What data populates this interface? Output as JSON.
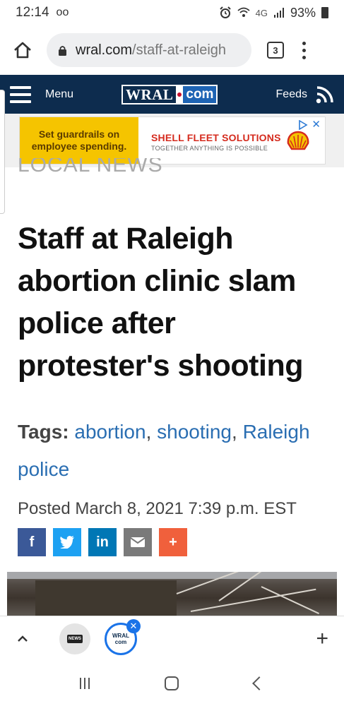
{
  "status_bar": {
    "time": "12:14",
    "voicemail": "oo",
    "network": "4G",
    "battery": "93%"
  },
  "browser": {
    "url_host": "wral.com",
    "url_path": "/staff-at-raleigh",
    "tab_count": "3"
  },
  "site_header": {
    "menu_label": "Menu",
    "logo_wral": "WRAL",
    "logo_com": "com",
    "feeds_label": "Feeds"
  },
  "ad": {
    "left_text": "Set guardrails on employee spending.",
    "title": "SHELL FLEET SOLUTIONS",
    "subtitle": "TOGETHER ANYTHING IS POSSIBLE",
    "close": "✕"
  },
  "article": {
    "section": "LOCAL NEWS",
    "headline": "Staff at Raleigh abortion clinic slam police after protester's shooting",
    "tags_label": "Tags:",
    "tags": [
      "abortion",
      "shooting",
      "Raleigh police"
    ],
    "posted": "Posted March 8, 2021 7:39 p.m. EST"
  },
  "share": {
    "facebook": "f",
    "linkedin": "in",
    "more": "+"
  },
  "bottom_bar": {
    "tab1_label": "NEWS",
    "tab2_logo_top": "WRAL",
    "tab2_logo_bottom": "com",
    "tab_close": "✕",
    "new_tab": "+"
  },
  "colors": {
    "header_bg": "#0d2c4e",
    "link": "#2a6eb2",
    "ad_yellow": "#f5c400",
    "ad_red": "#d52b1e",
    "accent_blue": "#1a73e8"
  }
}
